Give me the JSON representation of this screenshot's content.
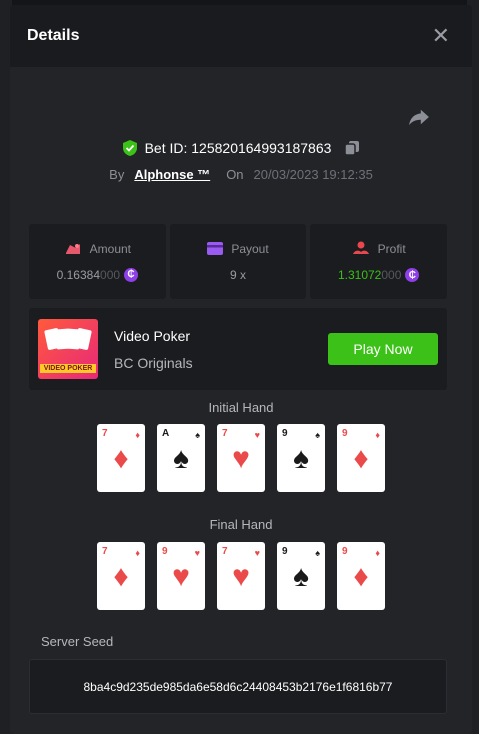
{
  "header": {
    "title": "Details"
  },
  "bet": {
    "label": "Bet ID: 125820164993187863",
    "by_label": "By",
    "user": "Alphonse ™",
    "on_label": "On",
    "date": "20/03/2023 19:12:35"
  },
  "stats": {
    "amount": {
      "label": "Amount",
      "value_main": "0.16384",
      "value_dim": "000"
    },
    "payout": {
      "label": "Payout",
      "value": "9 x"
    },
    "profit": {
      "label": "Profit",
      "value_main": "1.31072",
      "value_dim": "000"
    }
  },
  "game": {
    "name": "Video Poker",
    "provider": "BC Originals",
    "thumb_text": "VIDEO POKER",
    "play_label": "Play Now"
  },
  "initial_hand": {
    "title": "Initial Hand",
    "cards": [
      {
        "rank": "7",
        "suit": "♦",
        "color": "red"
      },
      {
        "rank": "A",
        "suit": "♠",
        "color": "black"
      },
      {
        "rank": "7",
        "suit": "♥",
        "color": "red"
      },
      {
        "rank": "9",
        "suit": "♠",
        "color": "black"
      },
      {
        "rank": "9",
        "suit": "♦",
        "color": "red"
      }
    ]
  },
  "final_hand": {
    "title": "Final Hand",
    "cards": [
      {
        "rank": "7",
        "suit": "♦",
        "color": "red"
      },
      {
        "rank": "9",
        "suit": "♥",
        "color": "red"
      },
      {
        "rank": "7",
        "suit": "♥",
        "color": "red"
      },
      {
        "rank": "9",
        "suit": "♠",
        "color": "black"
      },
      {
        "rank": "9",
        "suit": "♦",
        "color": "red"
      }
    ]
  },
  "seed": {
    "label": "Server Seed",
    "value": "8ba4c9d235de985da6e58d6c24408453b2176e1f6816b77"
  },
  "colors": {
    "accent_green": "#3bc117",
    "coin_purple": "#8e3fe8",
    "shield_green": "#3bc117"
  },
  "icons": [
    "close-icon",
    "share-icon",
    "shield-check-icon",
    "copy-icon",
    "amount-icon",
    "payout-icon",
    "profit-icon",
    "coin-icon"
  ]
}
